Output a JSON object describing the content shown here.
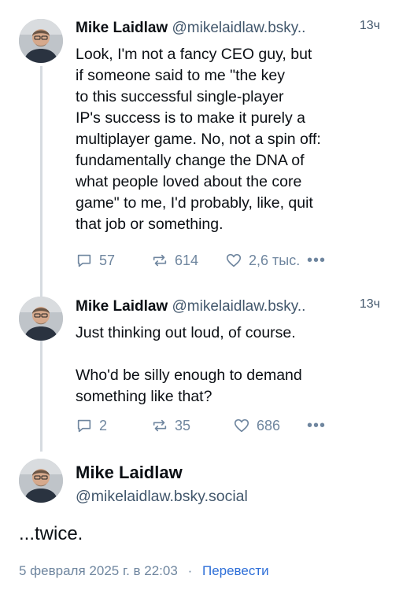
{
  "posts": [
    {
      "author": "Mike Laidlaw",
      "handle": "@mikelaidlaw.bsky..",
      "time": "13ч",
      "text": "Look, I'm not a fancy CEO guy, but\nif someone said to me \"the key\nto this successful  single-player\nIP's success is to make it purely a\nmultiplayer game. No, not a spin off:\nfundamentally change the DNA of\nwhat people loved about the core\ngame\" to me, I'd probably, like, quit\nthat job or something.",
      "replies": "57",
      "reposts": "614",
      "likes": "2,6 тыс."
    },
    {
      "author": "Mike Laidlaw",
      "handle": "@mikelaidlaw.bsky..",
      "time": "13ч",
      "text": "Just thinking out loud, of course.\n\nWho'd be silly enough to demand\nsomething like that?",
      "replies": "2",
      "reposts": "35",
      "likes": "686"
    }
  ],
  "main_post": {
    "author": "Mike Laidlaw",
    "handle": "@mikelaidlaw.bsky.social",
    "text": "...twice.",
    "date": "5 февраля 2025 г. в 22:03",
    "separator": "·",
    "translate": "Перевести"
  },
  "icons": {
    "reply": "reply-icon",
    "repost": "repost-icon",
    "like": "heart-icon",
    "more": "more-options-icon"
  },
  "colors": {
    "text": "#0b0f14",
    "muted": "#42576c",
    "icon": "#6f869f",
    "link": "#2e6fd8",
    "thread_line": "#d6dbe0"
  }
}
